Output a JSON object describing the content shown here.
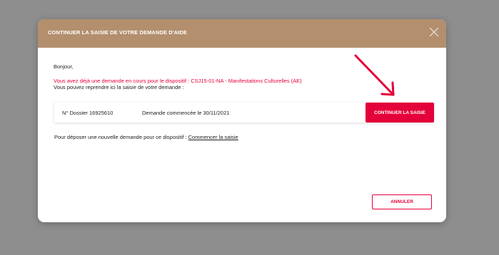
{
  "modal": {
    "title": "CONTINUER LA SAISIE DE VOTRE DEMANDE D'AIDE",
    "close_icon": "close-icon",
    "greeting": "Bonjour,",
    "alert_text": "Vous avez déjà une demande en cours pour le dispositif : CSJ15-01-NA - Manifestations Culturelles (AE)",
    "resume_text": "Vous pouvez reprendre ici la saisie de votre demande :",
    "dossier": {
      "number_label": "N° Dossier 16925610",
      "date_label": "Demande commencée le 30/11/2021",
      "continue_label": "CONTINUER LA SAISIE"
    },
    "new_request": {
      "text": "Pour déposer une nouvelle demande pour ce dispositif : ",
      "link": "Commencer la saisie"
    },
    "cancel_label": "ANNULER"
  },
  "colors": {
    "header": "#b38f6e",
    "accent": "#e4003a",
    "overlay": "#8e8e8e"
  },
  "annotation": {
    "icon": "arrow-pointer-icon"
  }
}
